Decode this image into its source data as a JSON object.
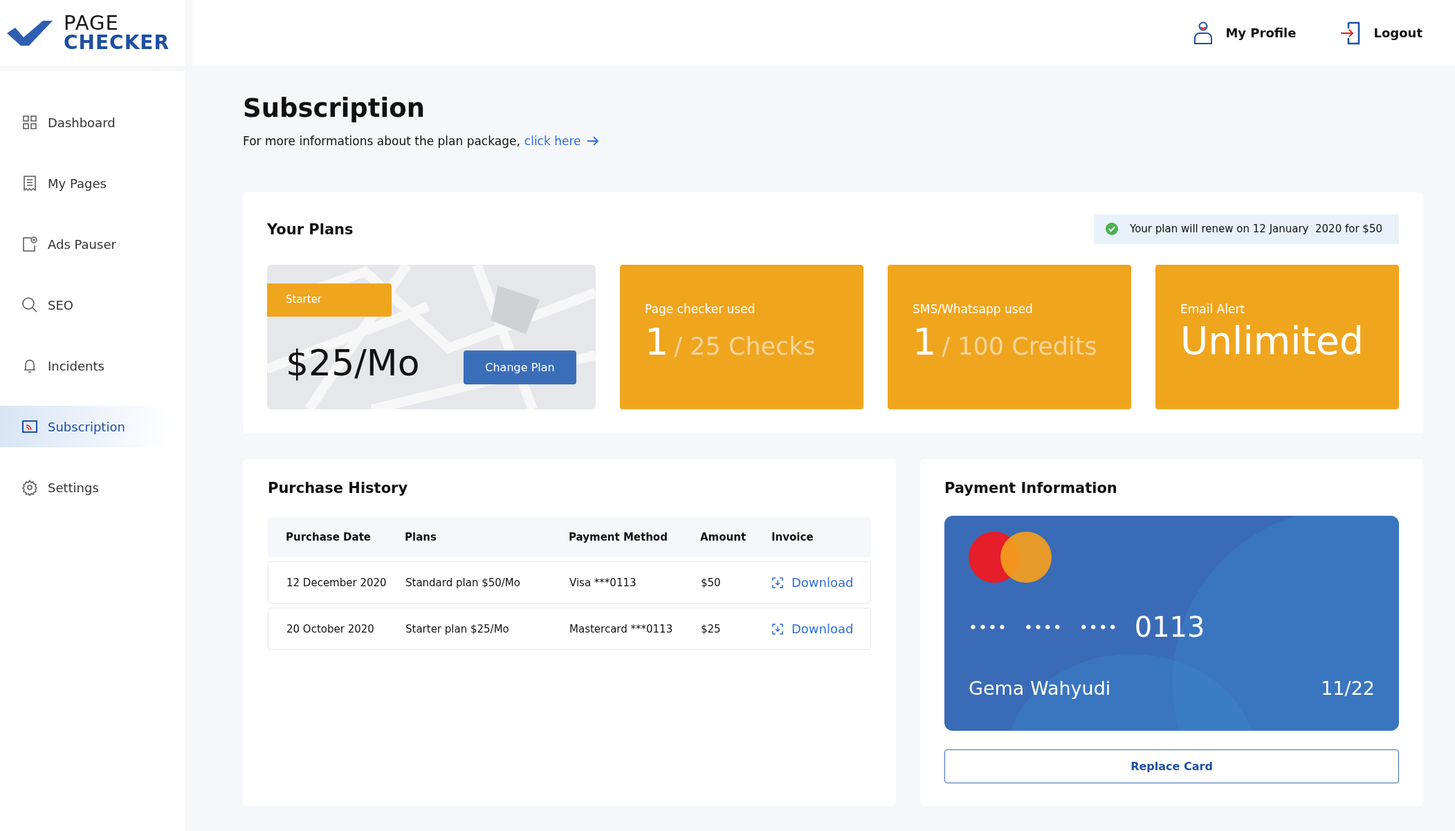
{
  "logo": {
    "line1": "PAGE",
    "line2": "CHECKER"
  },
  "header": {
    "profile": "My Profile",
    "logout": "Logout"
  },
  "sidebar": {
    "items": [
      {
        "label": "Dashboard",
        "kind": "grid",
        "selected": false
      },
      {
        "label": "My Pages",
        "kind": "list",
        "selected": false
      },
      {
        "label": "Ads Pauser",
        "kind": "ads",
        "selected": false
      },
      {
        "label": "SEO",
        "kind": "search",
        "selected": false
      },
      {
        "label": "Incidents",
        "kind": "bell",
        "selected": false
      },
      {
        "label": "Subscription",
        "kind": "card",
        "selected": true
      },
      {
        "label": "Settings",
        "kind": "gear",
        "selected": false
      }
    ]
  },
  "page": {
    "title": "Subscription",
    "intro": "For more informations about the plan package,",
    "link": "click here"
  },
  "plans": {
    "title": "Your Plans",
    "renewal": "Your plan will renew on 12 January  2020 for $50",
    "current": {
      "badge": "Starter",
      "price": "$25/Mo",
      "button": "Change Plan"
    },
    "tiles": [
      {
        "kind": "usage",
        "label": "Page checker used",
        "value": "1",
        "unit": "/ 25 Checks"
      },
      {
        "kind": "usage",
        "label": "SMS/Whatsapp used",
        "value": "1",
        "unit": "/ 100 Credits"
      },
      {
        "kind": "text",
        "label": "Email Alert",
        "value": "Unlimited"
      }
    ]
  },
  "history": {
    "title": "Purchase History",
    "columns": [
      "Purchase Date",
      "Plans",
      "Payment Method",
      "Amount",
      "Invoice"
    ],
    "rows": [
      {
        "date": "12 December 2020",
        "plan": "Standard plan $50/Mo",
        "method": "Visa ***0113",
        "amount": "$50",
        "invoice": "Download"
      },
      {
        "date": "20 October 2020",
        "plan": "Starter plan $25/Mo",
        "method": "Mastercard ***0113",
        "amount": "$25",
        "invoice": "Download"
      }
    ]
  },
  "payment": {
    "title": "Payment Information",
    "card": {
      "masked": [
        "••••",
        "••••",
        "••••"
      ],
      "last4": "0113",
      "holder": "Gema Wahyudi",
      "expiry": "11/22"
    },
    "button": "Replace Card"
  }
}
